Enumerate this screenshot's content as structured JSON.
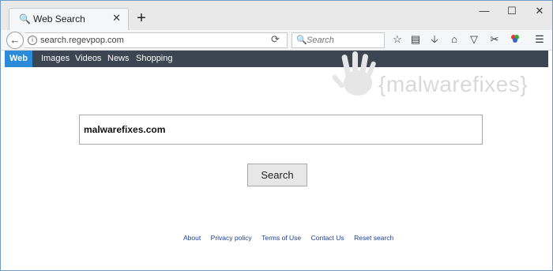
{
  "tab": {
    "icon": "search-icon",
    "title": "Web Search",
    "close_glyph": "✕"
  },
  "new_tab_glyph": "+",
  "window_controls": {
    "minimize": "—",
    "maximize": "☐",
    "close": "✕"
  },
  "navbar": {
    "back_glyph": "←",
    "url": "search.regevpop.com",
    "search_placeholder": "Search"
  },
  "site_nav": [
    "Web",
    "Images",
    "Videos",
    "News",
    "Shopping"
  ],
  "watermark": "{malwarefixes}",
  "main": {
    "search_value": "malwarefixes.com",
    "search_button": "Search"
  },
  "footer_links": [
    "About",
    "Privacy policy",
    "Terms of Use",
    "Contact Us",
    "Reset search"
  ],
  "colors": {
    "site_nav_bg": "#3c4652",
    "active_tab": "#2b8bd8",
    "footer_link": "#1a3f8f"
  }
}
